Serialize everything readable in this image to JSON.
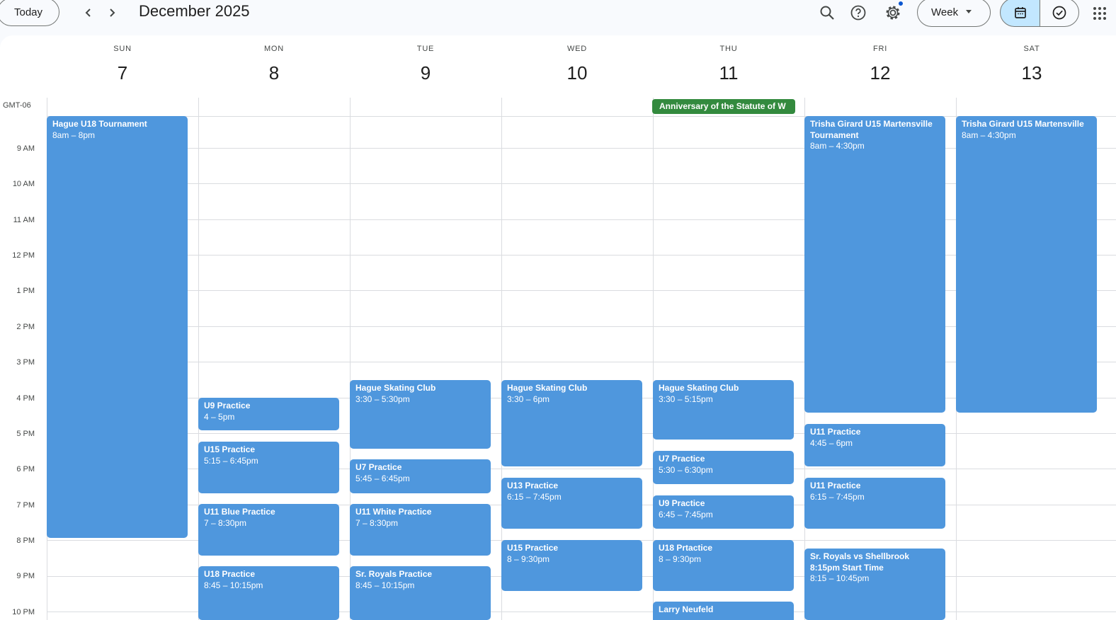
{
  "toolbar": {
    "today_label": "Today",
    "prev_icon": "‹",
    "next_icon": "›",
    "month_title": "December 2025",
    "view_label": "Week",
    "icons": [
      "search-icon",
      "help-icon",
      "settings-icon",
      "calendar-icon",
      "tasks-icon",
      "apps-grid-icon"
    ],
    "accent_color": "#c2e7ff"
  },
  "timezone": "GMT-06",
  "days": [
    {
      "dow": "SUN",
      "num": "7"
    },
    {
      "dow": "MON",
      "num": "8"
    },
    {
      "dow": "TUE",
      "num": "9"
    },
    {
      "dow": "WED",
      "num": "10"
    },
    {
      "dow": "THU",
      "num": "11"
    },
    {
      "dow": "FRI",
      "num": "12"
    },
    {
      "dow": "SAT",
      "num": "13"
    }
  ],
  "hours": [
    "9 AM",
    "10 AM",
    "11 AM",
    "12 PM",
    "1 PM",
    "2 PM",
    "3 PM",
    "4 PM",
    "5 PM",
    "6 PM",
    "7 PM",
    "8 PM",
    "9 PM",
    "10 PM"
  ],
  "all_day": {
    "title": "Anniversary of the Statute of W",
    "color": "#338a3e"
  },
  "event_color": "#4f97dd",
  "events": [
    {
      "title": "Hague U18 Tournament",
      "time": "8am – 8pm"
    },
    {
      "title": "U9 Practice",
      "time": "4 – 5pm"
    },
    {
      "title": "U15 Practice",
      "time": "5:15 – 6:45pm"
    },
    {
      "title": "U11 Blue Practice",
      "time": "7 – 8:30pm"
    },
    {
      "title": "U18 Practice",
      "time": "8:45 – 10:15pm"
    },
    {
      "title": "Hague Skating Club",
      "time": "3:30 – 5:30pm"
    },
    {
      "title": "U7 Practice",
      "time": "5:45 – 6:45pm"
    },
    {
      "title": "U11 White Practice",
      "time": "7 – 8:30pm"
    },
    {
      "title": "Sr. Royals Practice",
      "time": "8:45 – 10:15pm"
    },
    {
      "title": "Hague Skating Club",
      "time": "3:30 – 6pm"
    },
    {
      "title": "U13 Practice",
      "time": "6:15 – 7:45pm"
    },
    {
      "title": "U15 Practice",
      "time": "8 – 9:30pm"
    },
    {
      "title": "Hague Skating Club",
      "time": "3:30 – 5:15pm"
    },
    {
      "title": "U7 Practice",
      "time": "5:30 – 6:30pm"
    },
    {
      "title": "U9 Practice",
      "time": "6:45 – 7:45pm"
    },
    {
      "title": "U18 Prtactice",
      "time": "8 – 9:30pm"
    },
    {
      "title": "Larry Neufeld",
      "time": ""
    },
    {
      "title": "Trisha Girard U15 Martensville Tournament",
      "time": "8am – 4:30pm"
    },
    {
      "title": "U11 Practice",
      "time": "4:45 – 6pm"
    },
    {
      "title": "U11 Practice",
      "time": "6:15 – 7:45pm"
    },
    {
      "title": "Sr. Royals vs Shellbrook 8:15pm Start Time",
      "time": "8:15 – 10:45pm"
    },
    {
      "title": "Trisha Girard U15 Martensville",
      "time": "8am – 4:30pm"
    }
  ]
}
